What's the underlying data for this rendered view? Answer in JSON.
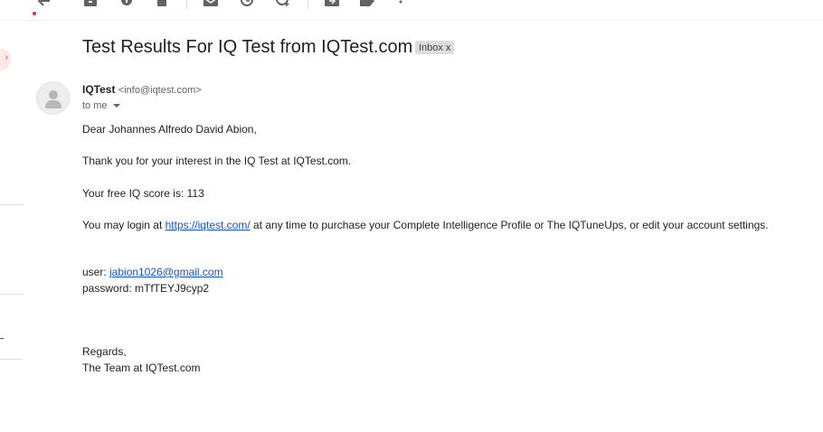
{
  "email": {
    "subject": "Test Results For IQ Test from IQTest.com",
    "label": "Inbox",
    "label_remove": "x",
    "sender_name": "IQTest",
    "sender_email": "<info@iqtest.com>",
    "to_line": "to me",
    "body": {
      "greeting": "Dear Johannes Alfredo David Abion,",
      "thanks": "Thank you for your interest in the IQ Test at IQTest.com.",
      "score": "Your free IQ score is: 113",
      "login_prefix": "You may login at ",
      "login_link": "https://iqtest.com/",
      "login_suffix": " at any time to purchase your Complete Intelligence Profile or The IQTuneUps, or edit your account settings.",
      "user_prefix": "user: ",
      "user_email": "jabion1026@gmail.com",
      "password": "password: mTfTEYJ9cyp2",
      "regards": "Regards,",
      "signature": "The Team at IQTest.com"
    }
  },
  "left_badge_glyph": "›",
  "toolbar_icons": [
    "back-arrow-icon",
    "archive-icon",
    "report-spam-icon",
    "delete-icon",
    "mark-unread-icon",
    "snooze-icon",
    "add-task-icon",
    "move-to-icon",
    "label-icon",
    "more-vert-icon"
  ],
  "colors": {
    "link": "#1155cc",
    "unread_dot": "#d93025",
    "badge_bg": "#fce8e6"
  }
}
